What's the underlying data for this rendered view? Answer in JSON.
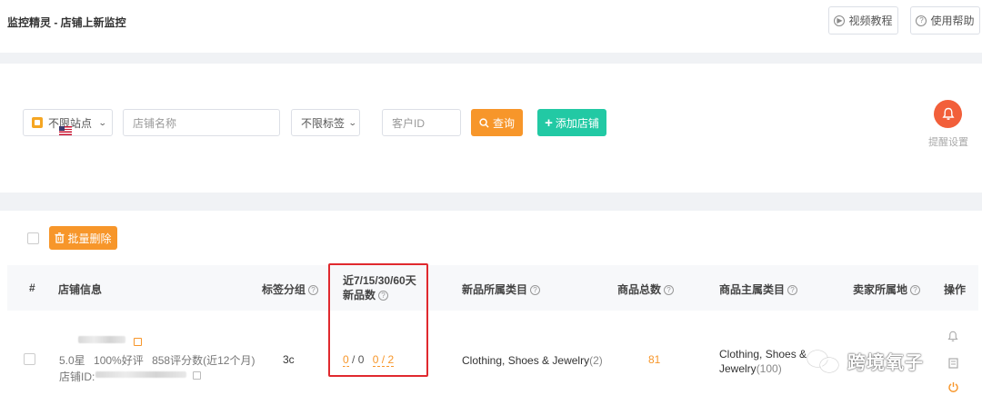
{
  "header": {
    "title": "监控精灵 - 店铺上新监控",
    "video_btn": "视频教程",
    "help_btn": "使用帮助"
  },
  "filters": {
    "site": "不限站点",
    "store_name_placeholder": "店铺名称",
    "tag": "不限标签",
    "customer_id_placeholder": "客户ID",
    "query_btn": "查询",
    "add_store_btn": "添加店铺",
    "alert_settings": "提醒设置"
  },
  "list": {
    "batch_delete": "批量删除",
    "columns": {
      "index": "#",
      "store_info": "店铺信息",
      "tag_group": "标签分组",
      "new_count_line1": "近7/15/30/60天",
      "new_count_line2": "新品数",
      "new_category": "新品所属类目",
      "total_products": "商品总数",
      "main_category": "商品主属类目",
      "seller_location": "卖家所属地",
      "actions": "操作"
    },
    "rows": [
      {
        "rating": "5.0星",
        "positive": "100%好评",
        "reviews": "858评分数(近12个月)",
        "store_id_label": "店铺ID:",
        "tag": "3c",
        "count_a": "0",
        "count_b": "0",
        "count_c": "0",
        "count_d": "2",
        "new_category": "Clothing, Shoes & Jewelry",
        "new_category_count": "(2)",
        "total": "81",
        "main_category_line1": "Clothing, Shoes &",
        "main_category_line2": "Jewelry",
        "main_category_count": "(100)"
      }
    ]
  },
  "watermark": "跨境氧子",
  "colors": {
    "orange": "#f7962a",
    "teal": "#22c9a4",
    "red_box": "#e0292e",
    "bell": "#f25f3a"
  }
}
